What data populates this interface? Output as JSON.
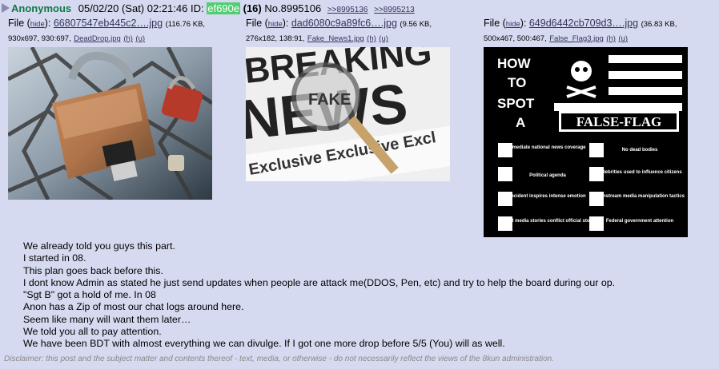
{
  "post": {
    "name": "Anonymous",
    "date": "05/02/20 (Sat) 02:21:46",
    "id_label": "ID:",
    "id": "ef690e",
    "count": "(16)",
    "number": "No.8995106",
    "replies": [
      ">>8995136",
      ">>8995213"
    ]
  },
  "files": [
    {
      "prefix": "File (",
      "hide": "hide",
      "sep": "): ",
      "name": "66807547eb445c2….jpg",
      "meta": "(116.76 KB, 930x697, 930:697,",
      "orig": "DeadDrop.jpg",
      "h": "(h)",
      "u": "(u)"
    },
    {
      "prefix": "File (",
      "hide": "hide",
      "sep": "): ",
      "name": "dad6080c9a89fc6….jpg",
      "meta": "(9.56 KB, 276x182, 138:91,",
      "orig": "Fake_News1.jpg",
      "h": "(h)",
      "u": "(u)",
      "img_text": {
        "breaking": "BREAKING",
        "news": "NEWS",
        "fake": "FAKE",
        "exclusive": "Exclusive Exclusive Excl"
      }
    },
    {
      "prefix": "File (",
      "hide": "hide",
      "sep": "): ",
      "name": "649d6442cb709d3….jpg",
      "meta": "(36.83 KB, 500x467, 500:467,",
      "orig": "False_Flag3.jpg",
      "h": "(h)",
      "u": "(u)",
      "img_text": {
        "how": "HOW",
        "to": "TO",
        "spot": "SPOT",
        "a": "A",
        "false_flag": "FALSE-FLAG",
        "items": [
          "Immediate national news coverage",
          "No dead bodies",
          "Political agenda",
          "Celebrities used to influence citizens",
          "Incident inspires intense emotion",
          "Mainstream media manipulation tactics",
          "Initial media stories conflict official story",
          "Federal government attention"
        ]
      }
    }
  ],
  "body_lines": [
    "We already told you guys this part.",
    "I started in 08.",
    "This plan goes back before this.",
    "I dont know Admin as stated he just send updates when people are attack me(DDOS, Pen, etc) and try to help the board during our op.",
    "\"Sgt B\" got a hold of me. In 08",
    "Anon has a Zip of most our chat logs around here.",
    "Seem like many will want them later…",
    "We told you all to pay attention.",
    "We have been BDT with almost everything we can divulge. If I got one more drop before 5/5 (You) will as well."
  ],
  "disclaimer": "Disclaimer: this post and the subject matter and contents thereof - text, media, or otherwise - do not necessarily reflect the views of the 8kun administration.",
  "colors": {
    "background": "#d6daf0",
    "name": "#117743",
    "id_bg": "#4fcf6f",
    "link": "#34345c"
  }
}
